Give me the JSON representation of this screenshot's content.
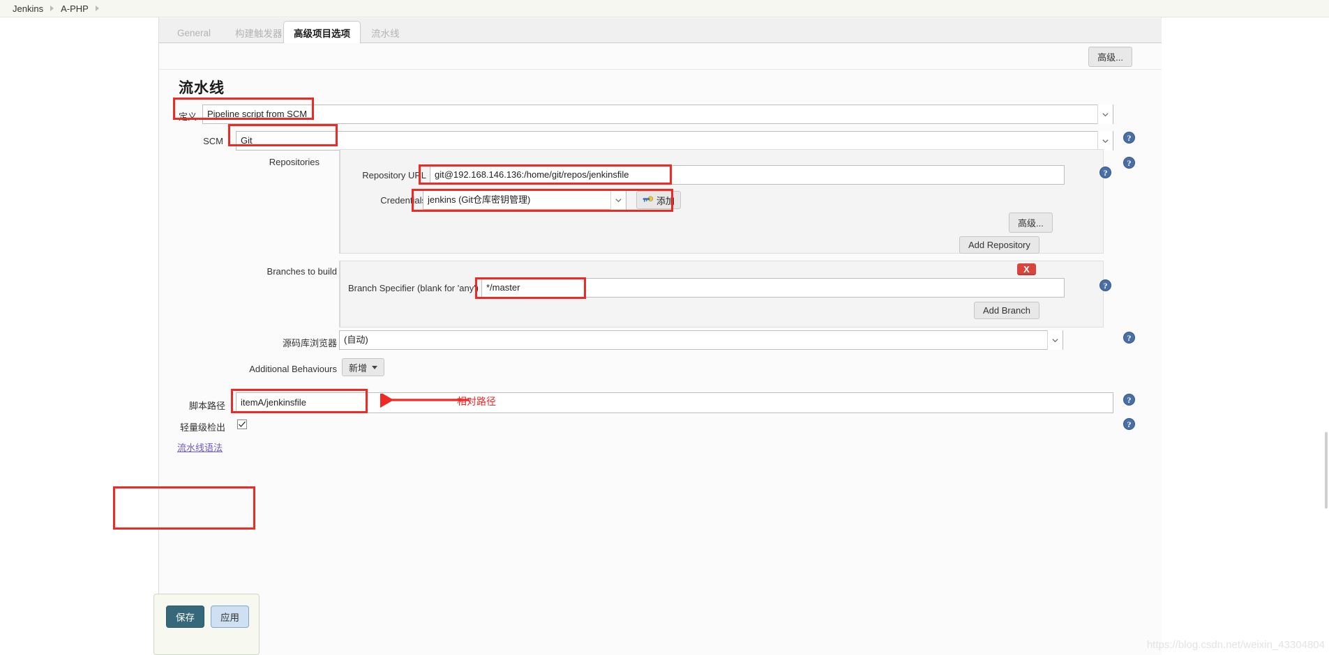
{
  "breadcrumb": {
    "items": [
      {
        "label": "Jenkins"
      },
      {
        "label": "A-PHP"
      }
    ]
  },
  "tabs": [
    {
      "label": "General",
      "active": false
    },
    {
      "label": "构建触发器",
      "active": false
    },
    {
      "label": "高级项目选项",
      "active": true
    },
    {
      "label": "流水线",
      "active": false
    }
  ],
  "toolbar": {
    "advanced_label": "高级..."
  },
  "pipeline": {
    "section_title": "流水线",
    "definition_label": "定义",
    "definition_value": "Pipeline script from SCM",
    "scm_label": "SCM",
    "scm_value": "Git",
    "repositories_label": "Repositories",
    "repository_url_label": "Repository URL",
    "repository_url_value": "git@192.168.146.136:/home/git/repos/jenkinsfile",
    "credentials_label": "Credentials",
    "credentials_value": "jenkins (Git仓库密钥管理)",
    "credentials_add_label": "添加",
    "repo_advanced_label": "高级...",
    "add_repository_label": "Add Repository",
    "branches_label": "Branches to build",
    "branch_delete_label": "X",
    "branch_specifier_label": "Branch Specifier (blank for 'any')",
    "branch_specifier_value": "*/master",
    "add_branch_label": "Add Branch",
    "repo_browser_label": "源码库浏览器",
    "repo_browser_value": "(自动)",
    "additional_behaviours_label": "Additional Behaviours",
    "additional_behaviours_add_label": "新增",
    "script_path_label": "脚本路径",
    "script_path_value": "itemA/jenkinsfile",
    "lightweight_label": "轻量级检出",
    "lightweight_checked": true,
    "pipeline_syntax_link": "流水线语法"
  },
  "annotations": {
    "relative_path_note": "相对路径"
  },
  "footer": {
    "save_label": "保存",
    "apply_label": "应用"
  },
  "watermark": "https://blog.csdn.net/weixin_43304804",
  "icons": {
    "help": "?",
    "chevron_down": "chevron-down-icon",
    "key": "key-icon",
    "check": "check-icon"
  },
  "colors": {
    "accent_red": "#ef2a24",
    "help_blue": "#4a6fa5",
    "save_teal": "#34687a",
    "apply_blue": "#cfe0f2",
    "delete_red": "#d9453c"
  }
}
